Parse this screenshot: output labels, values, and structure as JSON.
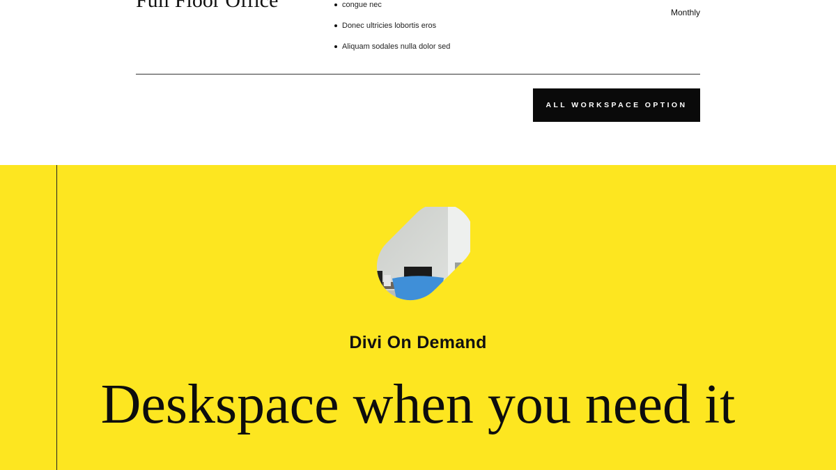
{
  "plan": {
    "title": "Full Floor Office",
    "features": [
      "congue nec",
      "Donec ultricies lobortis eros",
      "Aliquam sodales nulla dolor sed"
    ],
    "billing": "Monthly"
  },
  "cta": {
    "label": "All Workspace Option"
  },
  "hero": {
    "eyebrow": "Divi On Demand",
    "headline": "Deskspace when you need it",
    "image_label": "office-desk-blue-chair-photo",
    "background_color": "#fde620"
  }
}
